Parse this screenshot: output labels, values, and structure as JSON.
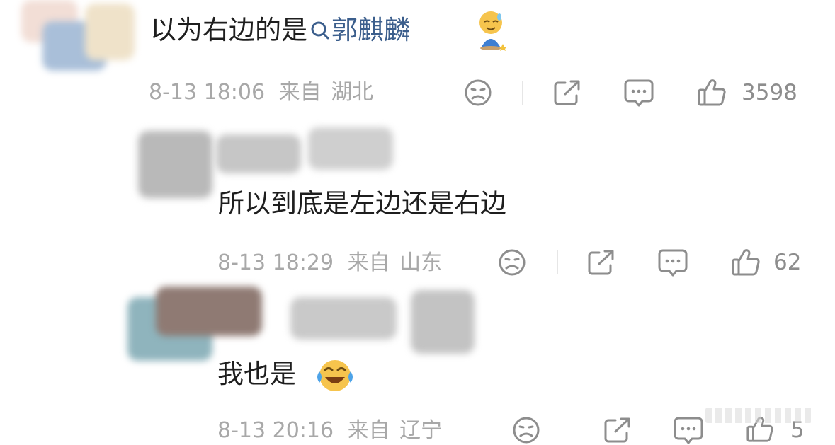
{
  "comments": [
    {
      "text_prefix": "以为右边的是",
      "topic_link": "郭麒麟",
      "date": "8-13 18:06",
      "from_label": "来自",
      "location": "湖北",
      "likes": "3598"
    },
    {
      "text": "所以到底是左边还是右边",
      "date": "8-13 18:29",
      "from_label": "来自",
      "location": "山东",
      "likes": "62"
    },
    {
      "text": "我也是",
      "date": "8-13 20:16",
      "from_label": "来自",
      "location": "辽宁",
      "likes": "5"
    }
  ],
  "icons": {
    "search": "search-icon",
    "emoji_sweat_smile": "emoji-person-icon",
    "emoji_laugh_cry": "emoji-laugh-cry-icon",
    "dislike": "frown-face-icon",
    "share": "share-icon",
    "reply": "comment-icon",
    "like": "thumbs-up-icon"
  },
  "colors": {
    "topic_link": "#3b5e8c",
    "meta_text": "#a8a8a8",
    "icon_stroke": "#8d8d8d"
  }
}
